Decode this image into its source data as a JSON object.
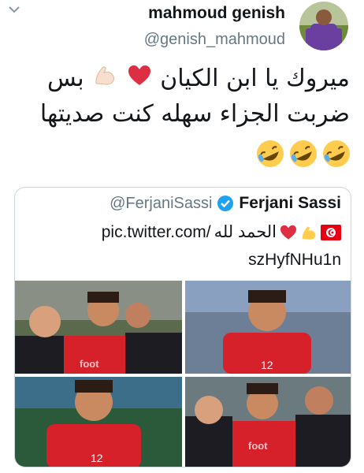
{
  "header": {
    "author_name": "mahmoud genish",
    "author_handle": "@genish_mahmoud",
    "icons": [
      "chevron-down-icon",
      "avatar-photo"
    ]
  },
  "tweet": {
    "line1_text": "بس",
    "line1_rest": "ميروك يا ابن الكيان",
    "line2": "ضربت الجزاء سهله كنت صديتها",
    "emojis": [
      "flexed-biceps",
      "red-heart",
      "rolling-on-floor-laughing x3"
    ]
  },
  "quoted": {
    "name": "Ferjani Sassi",
    "handle": "@FerjaniSassi",
    "line1_text": "الحمد لله",
    "line1_link": "pic.twitter.com/",
    "line2": "szHyfNHu1n",
    "watermark": "foot",
    "colors": {
      "shirt": "#d6202a",
      "handle": "#657786",
      "verified": "#1da1f2"
    }
  }
}
